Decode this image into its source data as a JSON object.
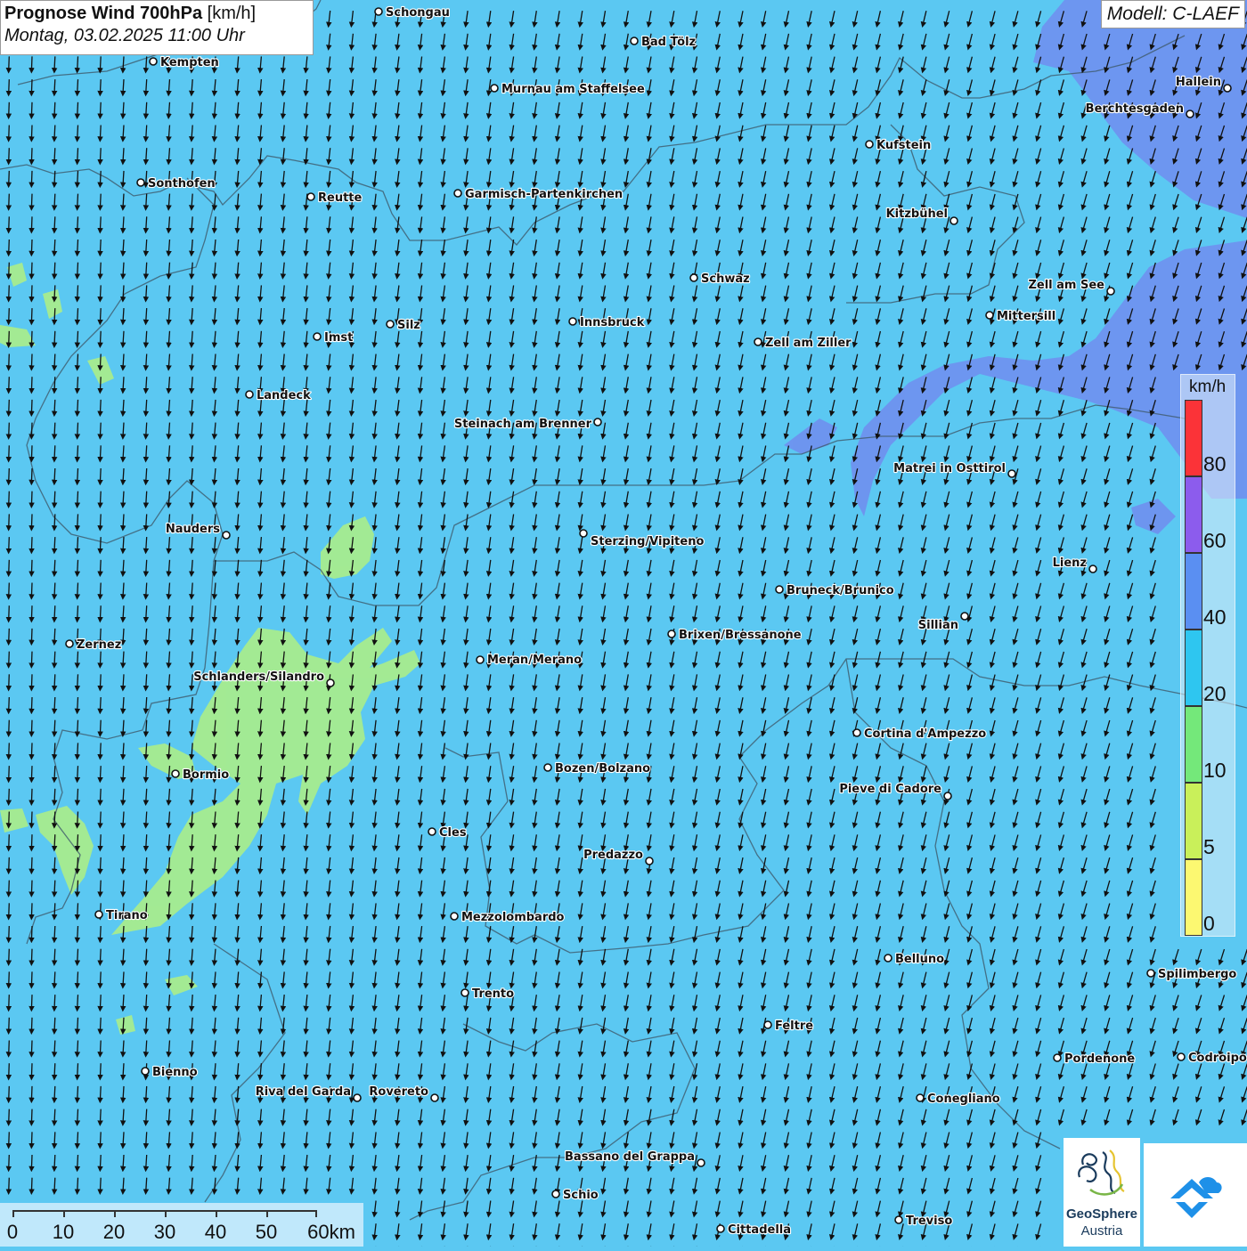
{
  "title": {
    "main": "Prognose Wind 700hPa",
    "unit": "[km/h]",
    "datetime": "Montag, 03.02.2025 11:00 Uhr"
  },
  "model": "Modell: C-LAEF",
  "legend": {
    "unit": "km/h",
    "ticks": [
      "80",
      "60",
      "40",
      "20",
      "10",
      "5",
      "0"
    ],
    "colors": [
      "#fb3338",
      "#8c5ced",
      "#5a8ff2",
      "#2ec6f0",
      "#74e87a",
      "#c9f05a",
      "#fcf871"
    ]
  },
  "scale_bar": {
    "labels": [
      "0",
      "10",
      "20",
      "30",
      "40",
      "50",
      "60km"
    ]
  },
  "cities": [
    "Schongau",
    "Bad Tölz",
    "Kempten",
    "Murnau am Staffelsee",
    "Hallein",
    "Berchtesgaden",
    "Kufstein",
    "Sonthofen",
    "Reutte",
    "Garmisch-Partenkirchen",
    "Kitzbühel",
    "Schwaz",
    "Zell am See",
    "Mittersill",
    "Innsbruck",
    "Silz",
    "Imst",
    "Zell am Ziller",
    "Landeck",
    "Steinach am Brenner",
    "Matrei in Osttirol",
    "Nauders",
    "Sterzing/Vipiteno",
    "Lienz",
    "Bruneck/Brunico",
    "Sillian",
    "Zernez",
    "Brixen/Bressanone",
    "Meran/Merano",
    "Schlanders/Silandro",
    "Cortina d'Ampezzo",
    "Bormio",
    "Bozen/Bolzano",
    "Pieve di Cadore",
    "Cles",
    "Predazzo",
    "Tirano",
    "Mezzolombardo",
    "Belluno",
    "Spilimbergo",
    "Trento",
    "Feltre",
    "Pordenone",
    "Codroipo",
    "Bienno",
    "Riva del Garda",
    "Rovereto",
    "Conegliano",
    "Bassano del Grappa",
    "Schio",
    "Treviso",
    "Cittadella"
  ],
  "wind": {
    "direction": "from north-northeast",
    "dominant_band": "20-40 km/h",
    "regions": [
      "10-20 km/h around Schlanders/Silandro and Bormio",
      "40-60 km/h north-east (Hallein, Berchtesgaden, Zell am See, Matrei in Osttirol)"
    ]
  },
  "logos": {
    "geosphere_line1": "GeoSphere",
    "geosphere_line2": "Austria"
  },
  "colors": {
    "background": "#5bc8f2",
    "zone_10_20": "#a8ec8c",
    "zone_40_60": "#6a8ff0"
  }
}
